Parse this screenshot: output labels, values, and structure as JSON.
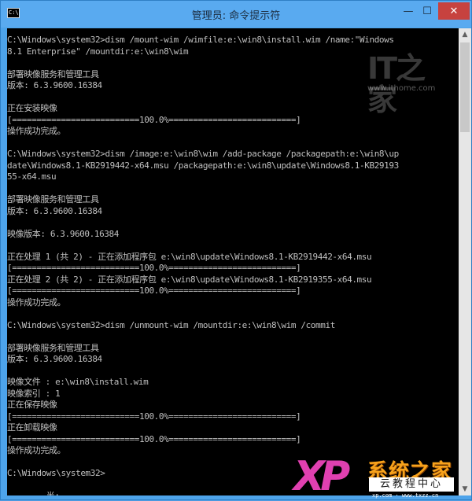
{
  "window": {
    "title": "管理员: 命令提示符",
    "icon_text": "C:\\",
    "buttons": {
      "minimize": "—",
      "maximize": "☐",
      "close": "✕"
    }
  },
  "console": {
    "lines": [
      "C:\\Windows\\system32>dism /mount-wim /wimfile:e:\\win8\\install.wim /name:\"Windows",
      "8.1 Enterprise\" /mountdir:e:\\win8\\wim",
      "",
      "部署映像服务和管理工具",
      "版本: 6.3.9600.16384",
      "",
      "正在安装映像",
      "[==========================100.0%==========================]",
      "操作成功完成。",
      "",
      "C:\\Windows\\system32>dism /image:e:\\win8\\wim /add-package /packagepath:e:\\win8\\up",
      "date\\Windows8.1-KB2919442-x64.msu /packagepath:e:\\win8\\update\\Windows8.1-KB29193",
      "55-x64.msu",
      "",
      "部署映像服务和管理工具",
      "版本: 6.3.9600.16384",
      "",
      "映像版本: 6.3.9600.16384",
      "",
      "正在处理 1 (共 2) - 正在添加程序包 e:\\win8\\update\\Windows8.1-KB2919442-x64.msu",
      "[==========================100.0%==========================]",
      "正在处理 2 (共 2) - 正在添加程序包 e:\\win8\\update\\Windows8.1-KB2919355-x64.msu",
      "[==========================100.0%==========================]",
      "操作成功完成。",
      "",
      "C:\\Windows\\system32>dism /unmount-wim /mountdir:e:\\win8\\wim /commit",
      "",
      "部署映像服务和管理工具",
      "版本: 6.3.9600.16384",
      "",
      "映像文件 : e:\\win8\\install.wim",
      "映像索引 : 1",
      "正在保存映像",
      "[==========================100.0%==========================]",
      "正在卸载映像",
      "[==========================100.0%==========================]",
      "操作成功完成。",
      "",
      "C:\\Windows\\system32>",
      "",
      "        半:"
    ]
  },
  "watermarks": {
    "ithome_logo": "IT之家",
    "ithome_url": "www.ithome.com",
    "xp_logo": "XP",
    "xp_title": "系统之家",
    "xp_subtitle": "云教程中心",
    "xp_url": "xp.com · www.txzz.cn"
  },
  "scrollbar": {
    "up": "▲",
    "down": "▼"
  },
  "colors": {
    "titlebar": "#59aaf0",
    "console_bg": "#000000",
    "console_text": "#c0c0c0",
    "close": "#c7423f"
  }
}
